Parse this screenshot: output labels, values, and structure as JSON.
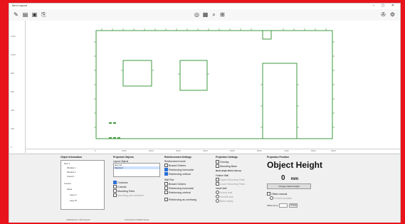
{
  "window": {
    "title": "Item Layout"
  },
  "toolbar": {
    "left_icons": [
      "new-file-icon",
      "open-file-icon",
      "save-file-icon",
      "export-icon"
    ],
    "center_icons": [
      "target-icon",
      "select-icon",
      "zoom-icon",
      "grid-icon"
    ],
    "right_icons": [
      "wrench-icon",
      "settings-icon"
    ]
  },
  "axes": {
    "y_ticks": [
      "0",
      "200",
      "400",
      "600",
      "800",
      "1000",
      "1200"
    ],
    "x_ticks": [
      "0",
      "1000",
      "2000",
      "3000",
      "4000",
      "5000",
      "6000",
      "7000",
      "8000",
      "9000"
    ]
  },
  "panels": {
    "object_info": {
      "title": "Object Information",
      "tree": [
        "Door 1",
        "Window 1",
        "Window 2",
        "Cutout 1",
        "Contour",
        "Studs",
        "Layer A",
        "Layer B"
      ],
      "status": "Calibrated for: Mounting kit"
    },
    "projected": {
      "title": "Projected Objects",
      "list_label": "Layout Objects",
      "list_items": [
        "Item list",
        "Selected"
      ],
      "checks": [
        {
          "label": "Contours",
          "checked": true
        },
        {
          "label": "Cutouts",
          "checked": false
        },
        {
          "label": "Mounting Parts",
          "checked": false
        }
      ],
      "filter_label": "Mounting part selection",
      "status": "Connected to Mobile device"
    },
    "reinforcement": {
      "title": "Reinforcement Settings",
      "sub1": "Reinforcement mode",
      "group1": [
        {
          "label": "Braced Girders",
          "checked": false
        },
        {
          "label": "Reinforcing horizontal",
          "checked": true
        },
        {
          "label": "Reinforcing vertical",
          "checked": true
        }
      ],
      "sub2": "Wall Plan",
      "group2": [
        {
          "label": "Braced Girders",
          "checked": false
        },
        {
          "label": "Reinforcing horizontal",
          "checked": false
        },
        {
          "label": "Reinforcing vertical",
          "checked": false
        }
      ],
      "extra": {
        "label": "Reinforcing as overhang",
        "checked": false
      }
    },
    "projection": {
      "title": "Projection Settings",
      "checks": [
        {
          "label": "Overlay",
          "checked": false
        },
        {
          "label": "Mounting Base",
          "checked": false
        }
      ],
      "note": "Multi-Height Wall (1 Ebene)",
      "sub1": "Feature Wall",
      "group1": [
        "Upper Mounting Parts",
        "Lower Mounting Parts"
      ],
      "sub2": "Inside Wall",
      "group2": [
        "Actual wall",
        "Overfill wall",
        "Build reality"
      ]
    },
    "projection_position": {
      "title": "Projection Position",
      "heading": "Object Height",
      "value": "0",
      "unit": "mm",
      "button": "Change Object Height",
      "offset_label": "Offset manual",
      "radio": "Current position",
      "offset_field_label": "Offset [mm]",
      "apply": "Change"
    }
  }
}
